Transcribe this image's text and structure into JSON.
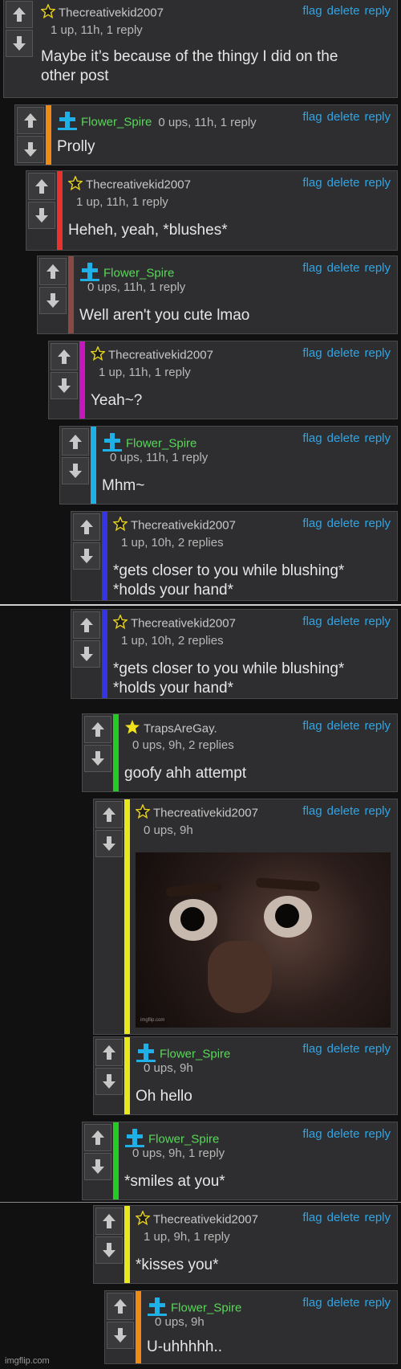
{
  "actions": {
    "flag": "flag",
    "delete": "delete",
    "reply": "reply"
  },
  "colors": {
    "orange": "#f08a16",
    "red": "#e8322e",
    "brown": "#8a4a44",
    "magenta": "#c516c0",
    "cyan": "#1fb0e8",
    "blue": "#3434e4",
    "green": "#22cc22",
    "yellow": "#e8e81a",
    "action": "#2ea6e6"
  },
  "comments": [
    {
      "user": "Thecreativekid2007",
      "icon": "star-outline",
      "stats": "1 up, 11h, 1 reply",
      "text1": "Maybe it’s because of the thingy I did on the",
      "text2": "other post"
    },
    {
      "user": "Flower_Spire",
      "icon": "cross",
      "stats": "0 ups, 11h, 1 reply",
      "text1": "Prolly"
    },
    {
      "user": "Thecreativekid2007",
      "icon": "star-outline",
      "stats": "1 up, 11h, 1 reply",
      "text1": "Heheh, yeah, *blushes*"
    },
    {
      "user": "Flower_Spire",
      "icon": "cross",
      "stats": "0 ups, 11h, 1 reply",
      "text1": "Well aren't you cute lmao"
    },
    {
      "user": "Thecreativekid2007",
      "icon": "star-outline",
      "stats": "1 up, 11h, 1 reply",
      "text1": "Yeah~?"
    },
    {
      "user": "Flower_Spire",
      "icon": "cross",
      "stats": "0 ups, 11h, 1 reply",
      "text1": "Mhm~"
    },
    {
      "user": "Thecreativekid2007",
      "icon": "star-outline",
      "stats": "1 up, 10h, 2 replies",
      "text1": "*gets closer to you while blushing*",
      "text2": "*holds your hand*"
    },
    {
      "user": "Thecreativekid2007",
      "icon": "star-outline",
      "stats": "1 up, 10h, 2 replies",
      "text1": "*gets closer to you while blushing*",
      "text2": "*holds your hand*"
    },
    {
      "user": "TrapsAreGay.",
      "icon": "star-filled",
      "stats": "0 ups, 9h, 2 replies",
      "text1": "goofy ahh attempt"
    },
    {
      "user": "Thecreativekid2007",
      "icon": "star-outline",
      "stats": "0 ups, 9h",
      "image_watermark": "imgflip.com"
    },
    {
      "user": "Flower_Spire",
      "icon": "cross",
      "stats": "0 ups, 9h",
      "text1": "Oh hello"
    },
    {
      "user": "Flower_Spire",
      "icon": "cross",
      "stats": "0 ups, 9h, 1 reply",
      "text1": "*smiles at you*"
    },
    {
      "user": "Thecreativekid2007",
      "icon": "star-outline",
      "stats": "1 up, 9h, 1 reply",
      "text1": "*kisses you*"
    },
    {
      "user": "Flower_Spire",
      "icon": "cross",
      "stats": "0 ups, 9h",
      "text1": "U-uhhhhh.."
    }
  ],
  "footer": {
    "watermark": "imgflip.com"
  }
}
